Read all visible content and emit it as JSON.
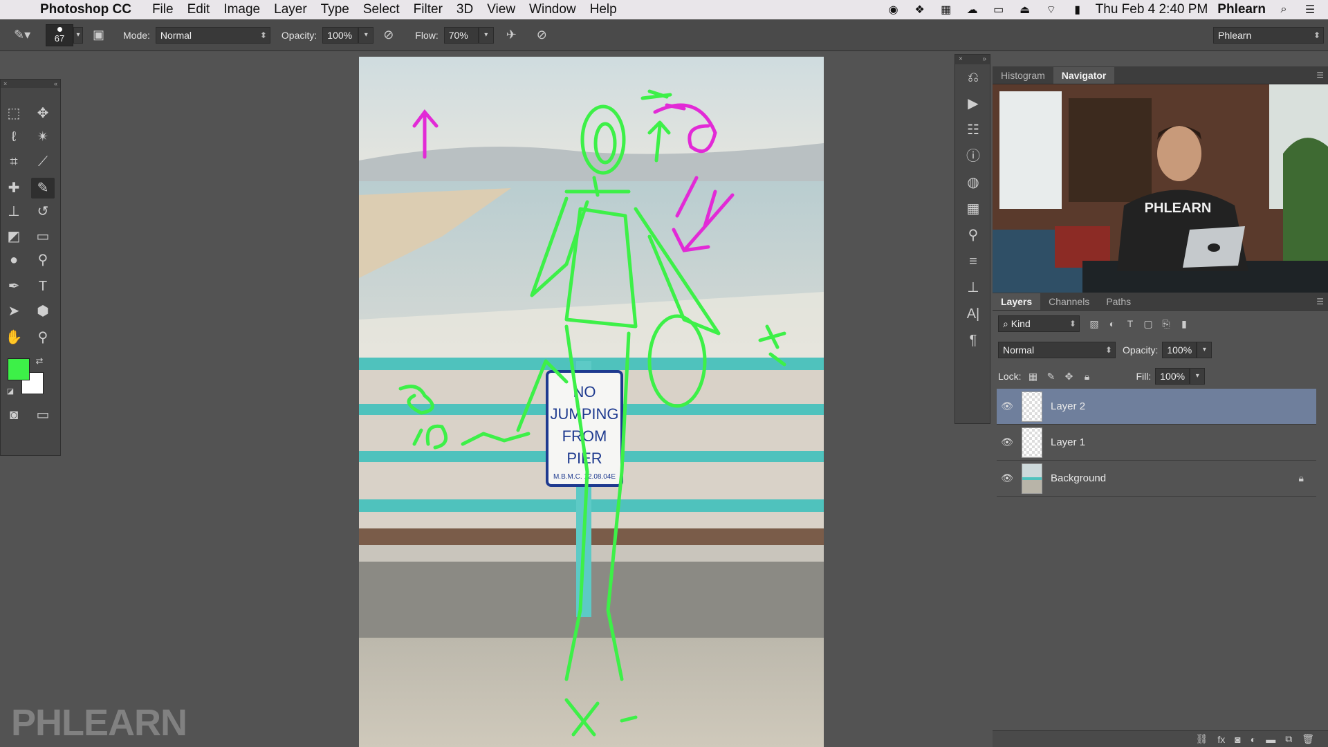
{
  "menubar": {
    "app_name": "Photoshop CC",
    "menus": [
      "File",
      "Edit",
      "Image",
      "Layer",
      "Type",
      "Select",
      "Filter",
      "3D",
      "View",
      "Window",
      "Help"
    ],
    "datetime": "Thu Feb 4  2:40 PM",
    "user": "Phlearn"
  },
  "options": {
    "brush_size": "67",
    "mode_label": "Mode:",
    "mode_value": "Normal",
    "opacity_label": "Opacity:",
    "opacity_value": "100%",
    "flow_label": "Flow:",
    "flow_value": "70%",
    "workspace": "Phlearn"
  },
  "tools": {
    "foreground_color": "#3df048",
    "background_color": "#ffffff"
  },
  "canvas": {
    "sign_lines": [
      "NO",
      "JUMPING",
      "FROM",
      "PIER"
    ],
    "sign_code": "M.B.M.C. 12.08.04E",
    "sketch_color": "#3df048",
    "arrow_color": "#e22ad6"
  },
  "navigator": {
    "tabs": [
      "Histogram",
      "Navigator"
    ],
    "active_tab": "Navigator",
    "shirt_text": "PHLEARN"
  },
  "layers": {
    "tabs": [
      "Layers",
      "Channels",
      "Paths"
    ],
    "filter_kind": "Kind",
    "blend_mode": "Normal",
    "opacity_label": "Opacity:",
    "opacity_value": "100%",
    "lock_label": "Lock:",
    "fill_label": "Fill:",
    "fill_value": "100%",
    "items": [
      {
        "name": "Layer 2",
        "selected": true,
        "locked": false
      },
      {
        "name": "Layer 1",
        "selected": false,
        "locked": false
      },
      {
        "name": "Background",
        "selected": false,
        "locked": true
      }
    ]
  },
  "watermark": "PHLEARN"
}
